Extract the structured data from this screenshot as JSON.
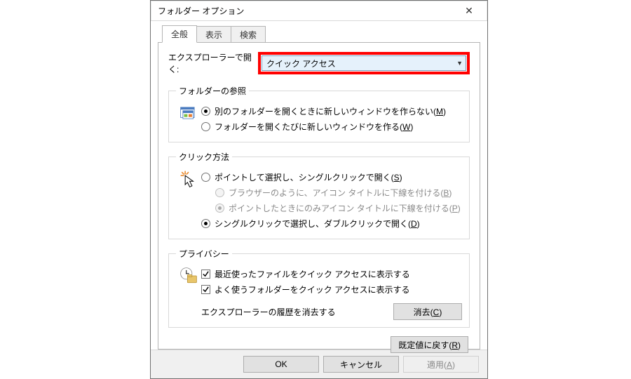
{
  "window": {
    "title": "フォルダー オプション",
    "close_glyph": "✕"
  },
  "tabs": {
    "general": "全般",
    "view": "表示",
    "search": "検索"
  },
  "open_in": {
    "label": "エクスプローラーで開く:",
    "selected": "クイック アクセス"
  },
  "browse": {
    "legend": "フォルダーの参照",
    "opt1_pre": "別のフォルダーを開くときに新しいウィンドウを作らない(",
    "opt1_key": "M",
    "opt1_post": ")",
    "opt2_pre": "フォルダーを開くたびに新しいウィンドウを作る(",
    "opt2_key": "W",
    "opt2_post": ")"
  },
  "click": {
    "legend": "クリック方法",
    "opt1_pre": "ポイントして選択し、シングルクリックで開く(",
    "opt1_key": "S",
    "opt1_post": ")",
    "sub1_pre": "ブラウザーのように、アイコン タイトルに下線を付ける(",
    "sub1_key": "B",
    "sub1_post": ")",
    "sub2_pre": "ポイントしたときにのみアイコン タイトルに下線を付ける(",
    "sub2_key": "P",
    "sub2_post": ")",
    "opt2_pre": "シングルクリックで選択し、ダブルクリックで開く(",
    "opt2_key": "D",
    "opt2_post": ")"
  },
  "privacy": {
    "legend": "プライバシー",
    "chk1": "最近使ったファイルをクイック アクセスに表示する",
    "chk2": "よく使うフォルダーをクイック アクセスに表示する",
    "clear_label": "エクスプローラーの履歴を消去する",
    "clear_btn_pre": "消去(",
    "clear_btn_key": "C",
    "clear_btn_post": ")"
  },
  "restore": {
    "pre": "既定値に戻す(",
    "key": "R",
    "post": ")"
  },
  "footer": {
    "ok": "OK",
    "cancel": "キャンセル",
    "apply_pre": "適用(",
    "apply_key": "A",
    "apply_post": ")"
  }
}
